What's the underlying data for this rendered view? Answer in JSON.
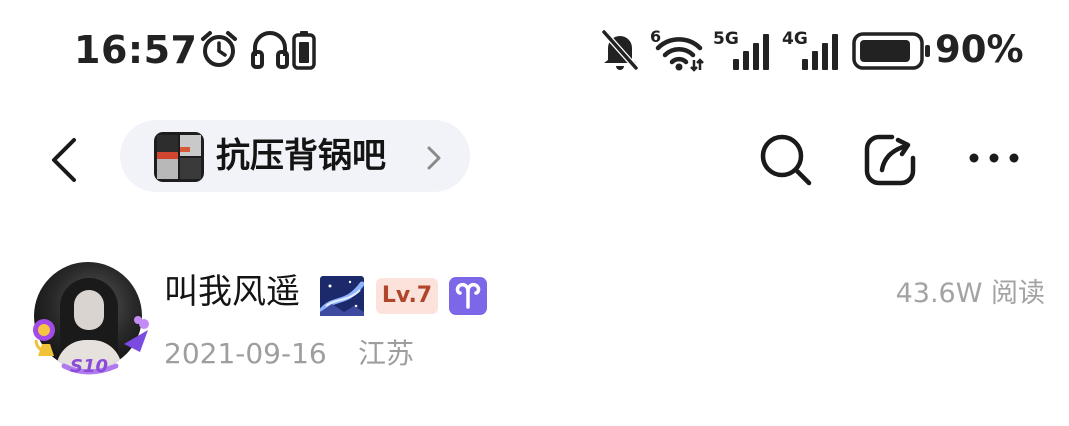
{
  "status_bar": {
    "time": "16:57",
    "icons": [
      "alarm-icon",
      "headphones-icon",
      "battery-saver-icon",
      "mute-icon",
      "wifi-icon",
      "5g-signal-icon",
      "4g-signal-icon",
      "battery-icon"
    ],
    "wifi_label": "6",
    "network_1": "5G",
    "network_2": "4G",
    "battery_percent": "90%",
    "battery_level": 0.9
  },
  "nav": {
    "forum_name": "抗压背锅吧",
    "icons": [
      "back-icon",
      "search-icon",
      "share-icon",
      "more-icon"
    ]
  },
  "post": {
    "author_name": "叫我风遥",
    "level": "Lv.7",
    "zodiac_symbol": "♈",
    "date": "2021-09-16",
    "location": "江苏",
    "read_count": "43.6W 阅读",
    "avatar_badge": "S10"
  },
  "colors": {
    "pill_background": "#f1f3f8",
    "level_badge_bg": "#fbe3dc",
    "level_badge_text": "#b0452b",
    "zodiac_badge_bg": "#7b67e8",
    "meta_text": "#9e9e9e"
  }
}
